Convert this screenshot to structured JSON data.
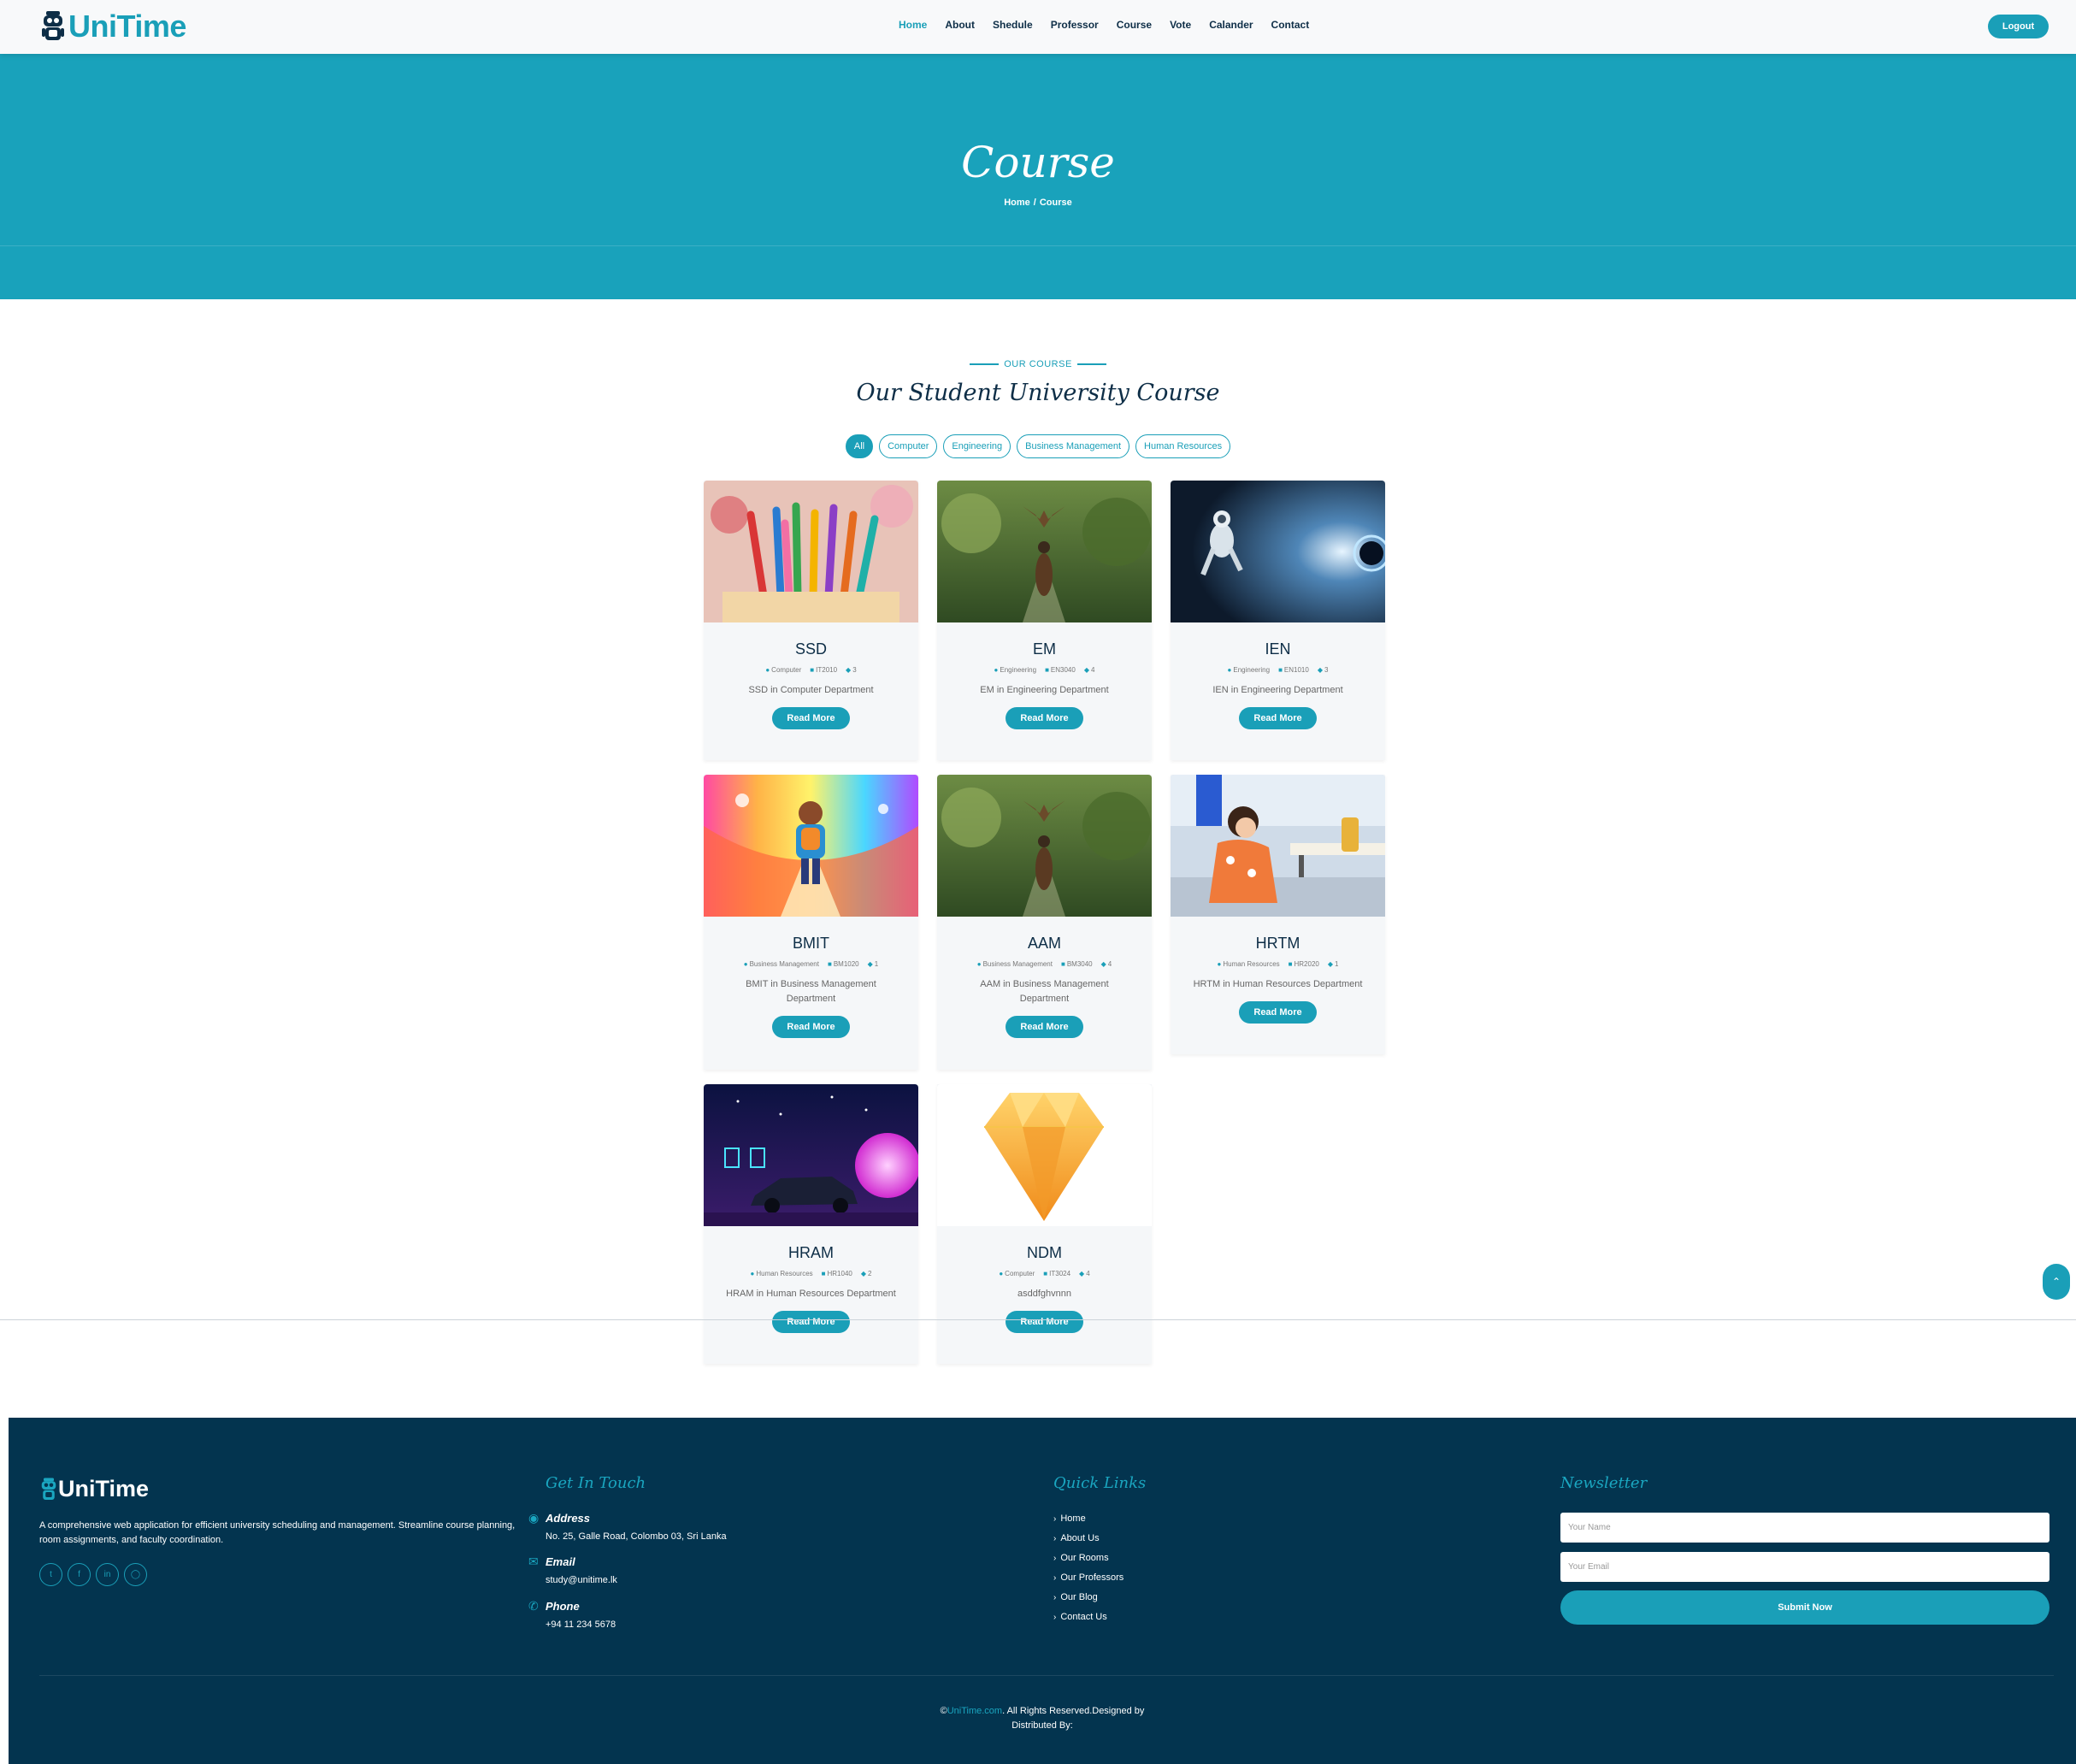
{
  "brand": {
    "name": "UniTime",
    "color": "#1a9fb8"
  },
  "nav": {
    "items": [
      "Home",
      "About",
      "Shedule",
      "Professor",
      "Course",
      "Vote",
      "Calander",
      "Contact"
    ],
    "active": "Home",
    "logout_label": "Logout"
  },
  "hero": {
    "title": "Course",
    "crumb_home": "Home",
    "crumb_sep": "/",
    "crumb_current": "Course"
  },
  "section": {
    "eyebrow": "OUR COURSE",
    "title": "Our Student University Course",
    "filters": [
      "All",
      "Computer",
      "Engineering",
      "Business Management",
      "Human Resources"
    ],
    "active_filter": "All"
  },
  "courses": [
    {
      "code": "SSD",
      "dept": "Computer",
      "id": "IT2010",
      "count": "3",
      "desc": "SSD in Computer Department",
      "image": "colored-pencils",
      "btn": "Read More"
    },
    {
      "code": "EM",
      "dept": "Engineering",
      "id": "EN3040",
      "count": "4",
      "desc": "EM in Engineering Department",
      "image": "rider-with-eagle",
      "btn": "Read More"
    },
    {
      "code": "IEN",
      "dept": "Engineering",
      "id": "EN1010",
      "count": "3",
      "desc": "IEN in Engineering Department",
      "image": "astronaut-space",
      "btn": "Read More"
    },
    {
      "code": "BMIT",
      "dept": "Business Management",
      "id": "BM1020",
      "count": "1",
      "desc": "BMIT in Business Management Department",
      "image": "kid-colorful-road",
      "btn": "Read More"
    },
    {
      "code": "AAM",
      "dept": "Business Management",
      "id": "BM3040",
      "count": "4",
      "desc": "AAM in Business Management Department",
      "image": "rider-with-eagle",
      "btn": "Read More"
    },
    {
      "code": "HRTM",
      "dept": "Human Resources",
      "id": "HR2020",
      "count": "1",
      "desc": "HRTM in Human Resources Department",
      "image": "child-classroom",
      "btn": "Read More"
    },
    {
      "code": "HRAM",
      "dept": "Human Resources",
      "id": "HR1040",
      "count": "2",
      "desc": "HRAM in Human Resources Department",
      "image": "retro-synthwave-car",
      "btn": "Read More"
    },
    {
      "code": "NDM",
      "dept": "Computer",
      "id": "IT3024",
      "count": "4",
      "desc": "asddfghvnnn",
      "image": "orange-gem",
      "btn": "Read More"
    }
  ],
  "footer": {
    "brand": "UniTime",
    "desc": "A comprehensive web application for efficient university scheduling and management. Streamline course planning, room assignments, and faculty coordination.",
    "socials": [
      "twitter-icon",
      "facebook-icon",
      "linkedin-icon",
      "instagram-icon"
    ],
    "contact_heading": "Get In Touch",
    "address_label": "Address",
    "address": "No. 25, Galle Road, Colombo 03, Sri Lanka",
    "email_label": "Email",
    "email": "study@unitime.lk",
    "phone_label": "Phone",
    "phone": "+94 11 234 5678",
    "links_heading": "Quick Links",
    "links": [
      "Home",
      "About Us",
      "Our Rooms",
      "Our Professors",
      "Our Blog",
      "Contact Us"
    ],
    "newsletter_heading": "Newsletter",
    "name_placeholder": "Your Name",
    "email_placeholder": "Your Email",
    "submit_label": "Submit Now",
    "copy_prefix": "©",
    "copy_brand": "UniTime.com",
    "copy_rest": ". All Rights Reserved.Designed by",
    "copy_line2": "Distributed By:"
  }
}
